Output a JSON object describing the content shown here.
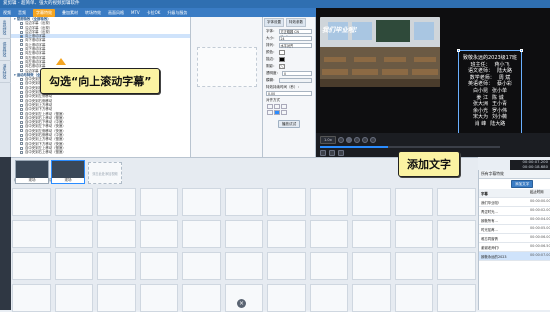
{
  "app": {
    "title": "爱剪辑 - 超简单、强大的视频剪辑软件"
  },
  "menu": [
    "视频",
    "音频",
    "字幕特效",
    "叠加素材",
    "转场特效",
    "画面风格",
    "MTV",
    "卡拉OK",
    "升级与服务"
  ],
  "menu_active_index": 2,
  "rail_tabs": [
    "出现特效",
    "停留特效",
    "消失特效"
  ],
  "tree": [
    {
      "label": "常用特效（全部特效）",
      "grp": true
    },
    {
      "label": "沿边字幕（出现）"
    },
    {
      "label": "沿边字幕（出现）"
    },
    {
      "label": "沿边字幕（出现）"
    },
    {
      "label": "向上滚动字幕",
      "sel": true
    },
    {
      "label": "向下滚动字幕"
    },
    {
      "label": "向上滚动字幕"
    },
    {
      "label": "向下滚动字幕"
    },
    {
      "label": "向左滚动字幕"
    },
    {
      "label": "向左滚动字幕"
    },
    {
      "label": "向左滚动字幕"
    },
    {
      "label": "向右滚动字幕"
    },
    {
      "label": "沿边字幕（出现）"
    },
    {
      "label": "运动与特效（全部）",
      "grp": true
    },
    {
      "label": "自中央到左上移动"
    },
    {
      "label": "自中央到右上移动"
    },
    {
      "label": "自中央到右下移动"
    },
    {
      "label": "自中央到左下移动"
    },
    {
      "label": "自中央到左侧移动"
    },
    {
      "label": "自中央到右侧移动"
    },
    {
      "label": "自中央到上方移动"
    },
    {
      "label": "自中央到下方移动"
    },
    {
      "label": "自中央到左上移动（慢速）"
    },
    {
      "label": "自中央到右上移动（慢速）"
    },
    {
      "label": "自中央到右下移动（中速）"
    },
    {
      "label": "自中央到左下移动（快速）"
    },
    {
      "label": "自中央到左侧移动（快速）"
    },
    {
      "label": "自中央到右侧移动（中速）"
    },
    {
      "label": "自中央到上方移动（慢速）"
    },
    {
      "label": "自中央到下方移动（快速）"
    },
    {
      "label": "自中央到左上移动（慢速）"
    },
    {
      "label": "自中央到右上移动（慢速）"
    }
  ],
  "props": {
    "tabs": [
      "字体设置",
      "特效参数"
    ],
    "font_label": "字体：",
    "font_value": "方正粗圆 CN Medium",
    "size_label": "大小：",
    "size_value": "24",
    "fill_label": "排列：",
    "fill_value": "水平对齐",
    "color_label": "颜色：",
    "stroke_label": "描边：",
    "shadow_label": "阴影：",
    "opacity_label": "透明度：",
    "opacity_value": "0",
    "blur_label": "模糊：",
    "anim_label": "特效持续时间（秒）：",
    "anim_value": "0.00",
    "align_label": "对齐方式",
    "apply_btn": "播放试试"
  },
  "preview": {
    "grad_title": "我们毕业啦!",
    "credits": [
      {
        "a": "致敬永远的2023级17班"
      },
      {
        "a": "班主任：",
        "b": "蒋小飞"
      },
      {
        "a": "语文老师：",
        "b": "陆大路"
      },
      {
        "a": "数学老师：",
        "b": "周 斌"
      },
      {
        "a": "英语老师：",
        "b": "蔡小彩"
      },
      {
        "a": "白小昆",
        "b": "张小单"
      },
      {
        "a": "姜 江",
        "b": "陈 诚"
      },
      {
        "a": "张大洲",
        "b": "王小青"
      },
      {
        "a": "余小光",
        "b": "罗小伟"
      },
      {
        "a": "宋大为",
        "b": "刘小薇"
      },
      {
        "a": "肖 峰",
        "b": "陆大路"
      }
    ]
  },
  "timecode": {
    "current": "00:00:07.200",
    "total": "00:00:18.680"
  },
  "transport": {
    "speed": "1.0x"
  },
  "timeline": {
    "hint": "在下方\"已添加片段\"列表进行剪辑",
    "clip_captions": [
      "现场",
      "现场"
    ],
    "placeholder": "双击此处添加视频",
    "panel_title": "所有字幕特效",
    "add_text": "添加文字",
    "col_headers": [
      "字幕",
      "起止时间"
    ],
    "rows": [
      {
        "t": "我们毕业啦!",
        "tm": "00:00:00.000",
        "sel": false
      },
      {
        "t": "青涩时光...",
        "tm": "00:00:02.000",
        "sel": false
      },
      {
        "t": "致敬所有...",
        "tm": "00:00:04.000",
        "sel": false
      },
      {
        "t": "时光荏苒...",
        "tm": "00:00:05.000",
        "sel": false
      },
      {
        "t": "难忘同窗情",
        "tm": "00:00:06.000",
        "sel": false
      },
      {
        "t": "谢谢老师们!",
        "tm": "00:00:06.500",
        "sel": false
      },
      {
        "t": "致敬永远的2023",
        "tm": "00:00:07.000",
        "sel": true
      }
    ]
  },
  "callouts": {
    "c1": "勾选“向上滚动字幕”",
    "c2": "添加文字"
  },
  "colors": {
    "accent": "#f5a623",
    "brand": "#2f6fb1",
    "callout_bg": "#fbf3a2"
  }
}
